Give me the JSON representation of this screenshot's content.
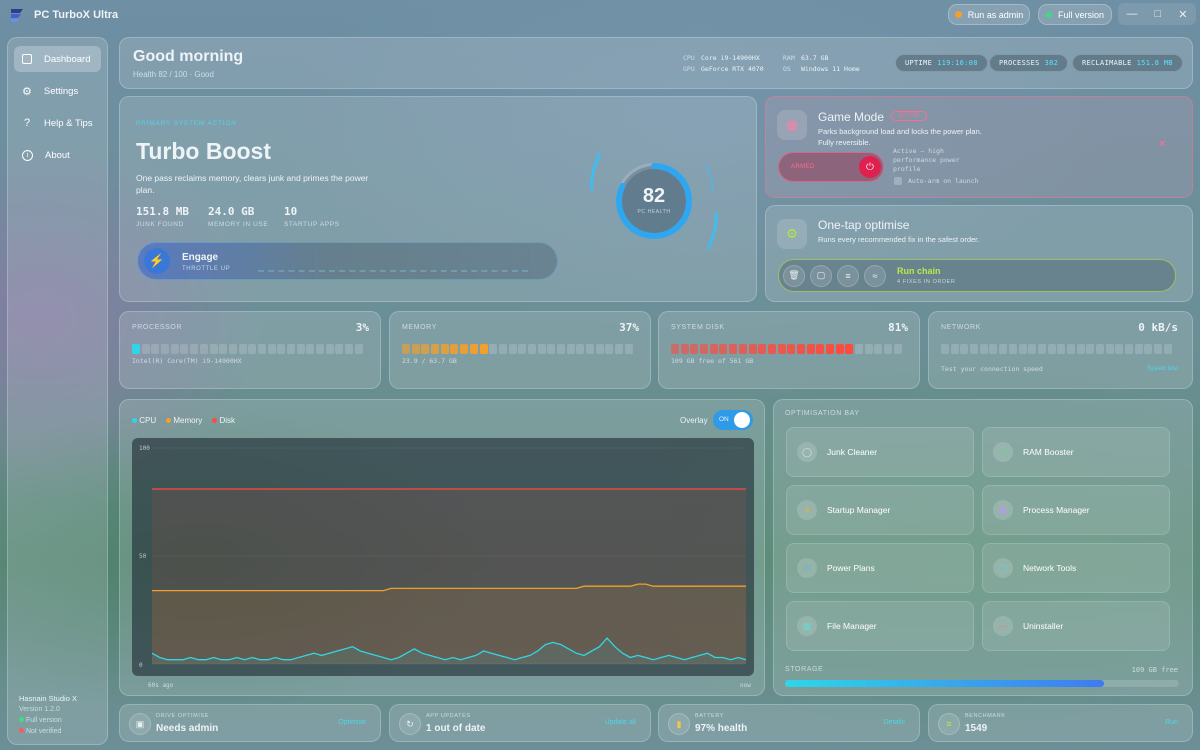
{
  "app": {
    "title": "PC TurboX Ultra",
    "run_admin": "Run as admin",
    "full_version": "Full version"
  },
  "sidebar": {
    "items": [
      {
        "label": "Dashboard",
        "icon": "dashboard-icon"
      },
      {
        "label": "Settings",
        "icon": "gear-icon"
      },
      {
        "label": "Help & Tips",
        "icon": "question-icon"
      },
      {
        "label": "About",
        "icon": "info-icon"
      }
    ],
    "studio": "Hasnain Studio X",
    "version": "Version 1.2.0",
    "full_version": "Full version",
    "not_verified": "Not verified",
    "colors": {
      "full": "#3ddc84",
      "unverified": "#ff5a5a"
    }
  },
  "header": {
    "greeting": "Good morning",
    "health": "Health 82 / 100",
    "health_state": "Good",
    "specs": {
      "cpu_label": "CPU",
      "cpu": "Core i9-14900HX",
      "gpu_label": "GPU",
      "gpu": "GeForce RTX 4070",
      "ram_label": "RAM",
      "ram": "63.7 GB",
      "os_label": "OS",
      "os": "Windows 11 Home"
    },
    "uptime_label": "UPTIME",
    "uptime": "119:16:08",
    "processes_label": "PROCESSES",
    "processes": "382",
    "reclaimable_label": "RECLAIMABLE",
    "reclaimable": "151.8 MB"
  },
  "boost": {
    "eyebrow": "PRIMARY SYSTEM ACTION",
    "title": "Turbo Boost",
    "desc": "One pass reclaims memory, clears junk and primes the power plan.",
    "stats": [
      {
        "value": "151.8 MB",
        "label": "JUNK FOUND"
      },
      {
        "value": "24.0 GB",
        "label": "MEMORY IN USE"
      },
      {
        "value": "10",
        "label": "STARTUP APPS"
      }
    ],
    "engage": "Engage",
    "engage_sub": "THROTTLE UP",
    "score": "82",
    "score_label": "PC HEALTH",
    "score_fraction": 0.82
  },
  "game_mode": {
    "title": "Game Mode",
    "badge": "ACTIVE",
    "desc": "Parks background load and locks the power plan. Fully reversible.",
    "armed": "ARMED",
    "status": "Active — high performance power profile",
    "auto_arm": "Auto-arm on launch"
  },
  "optimise": {
    "title": "One-tap optimise",
    "desc": "Runs every recommended fix in the safest order.",
    "run": "Run chain",
    "sub": "4 FIXES IN ORDER"
  },
  "meters": [
    {
      "label": "PROCESSOR",
      "value": "3%",
      "sub": "Intel(R) Core(TM) i9-14900HX",
      "fraction": 0.03,
      "color": "#31d6e6"
    },
    {
      "label": "MEMORY",
      "value": "37%",
      "sub": "23.9 / 63.7 GB",
      "fraction": 0.37,
      "color": "#f2a02b"
    },
    {
      "label": "SYSTEM DISK",
      "value": "81%",
      "sub": "109 GB free of 561 GB",
      "fraction": 0.81,
      "color": "#ff4a3d"
    },
    {
      "label": "NETWORK",
      "value": "0 kB/s",
      "sub": "Test your connection speed",
      "action": "Speed test",
      "fraction": 0,
      "color": "#31d6e6"
    }
  ],
  "chart_data": {
    "type": "line",
    "legend": [
      "CPU",
      "Memory",
      "Disk"
    ],
    "overlay_label": "Overlay",
    "toggle": "ON",
    "ylim": [
      0,
      100
    ],
    "y_ticks": [
      "100",
      "50",
      "0"
    ],
    "x_labels": [
      "60s ago",
      "now"
    ],
    "series": [
      {
        "name": "CPU",
        "color": "#31d6e6",
        "values": [
          5,
          3,
          2,
          2,
          2,
          3,
          2,
          2,
          3,
          2,
          2,
          3,
          2,
          3,
          2,
          2,
          3,
          2,
          2,
          3,
          4,
          5,
          4,
          5,
          6,
          7,
          8,
          6,
          5,
          4,
          3,
          2,
          3,
          5,
          7,
          5,
          4,
          3,
          2,
          3,
          2,
          3,
          4,
          6,
          5,
          4,
          3,
          2,
          3,
          4,
          6,
          9,
          10,
          9,
          7,
          5,
          4,
          6,
          8,
          12,
          8,
          5,
          3,
          4,
          3,
          2,
          3,
          4,
          3,
          2,
          3,
          4,
          5,
          3,
          3,
          2,
          3,
          2
        ]
      },
      {
        "name": "Memory",
        "color": "#f2a02b",
        "values": [
          34,
          34,
          34,
          34,
          34,
          34,
          34,
          34,
          34,
          34,
          34,
          34,
          34,
          34,
          34,
          34,
          34,
          34,
          34,
          34,
          34,
          34,
          34,
          34,
          34,
          34,
          34,
          34,
          34,
          34,
          34,
          35,
          35,
          35,
          35,
          35,
          35,
          35,
          35,
          35,
          35,
          35,
          35,
          35,
          35,
          35,
          35,
          35,
          35,
          35,
          35,
          35,
          35,
          35,
          35,
          35,
          36,
          36,
          36,
          36,
          36,
          36,
          36,
          37,
          37,
          36,
          36,
          36,
          36,
          36,
          36,
          36,
          36,
          36,
          36,
          36,
          36,
          36
        ]
      },
      {
        "name": "Disk",
        "color": "#ff4a3d",
        "values": [
          81,
          81,
          81,
          81,
          81,
          81,
          81,
          81,
          81,
          81,
          81,
          81,
          81,
          81,
          81,
          81,
          81,
          81,
          81,
          81,
          81,
          81,
          81,
          81,
          81,
          81,
          81,
          81,
          81,
          81,
          81,
          81,
          81,
          81,
          81,
          81,
          81,
          81,
          81,
          81,
          81,
          81,
          81,
          81,
          81,
          81,
          81,
          81,
          81,
          81,
          81,
          81,
          81,
          81,
          81,
          81,
          81,
          81,
          81,
          81,
          81,
          81,
          81,
          81,
          81,
          81,
          81,
          81,
          81,
          81,
          81,
          81,
          81,
          81,
          81,
          81,
          81,
          81
        ]
      }
    ]
  },
  "bay": {
    "title": "OPTIMISATION BAY",
    "tools": [
      {
        "label": "Junk Cleaner",
        "icon": "trash-icon"
      },
      {
        "label": "RAM Booster",
        "icon": "memory-icon"
      },
      {
        "label": "Startup Manager",
        "icon": "startup-icon"
      },
      {
        "label": "Process Manager",
        "icon": "process-icon"
      },
      {
        "label": "Power Plans",
        "icon": "power-icon"
      },
      {
        "label": "Network Tools",
        "icon": "globe-icon"
      },
      {
        "label": "File Manager",
        "icon": "folder-icon"
      },
      {
        "label": "Uninstaller",
        "icon": "uninstall-icon"
      }
    ],
    "storage_label": "STORAGE",
    "storage_free": "109 GB free",
    "storage_fraction": 0.81
  },
  "bottom": [
    {
      "label": "DRIVE OPTIMISE",
      "value": "Needs admin",
      "action": "Optimise",
      "icon": "drive-icon"
    },
    {
      "label": "APP UPDATES",
      "value": "1 out of date",
      "action": "Update all",
      "icon": "update-icon"
    },
    {
      "label": "BATTERY",
      "value": "97% health",
      "action": "Details",
      "icon": "battery-icon"
    },
    {
      "label": "BENCHMARK",
      "value": "1549",
      "action": "Run",
      "icon": "benchmark-icon"
    }
  ]
}
